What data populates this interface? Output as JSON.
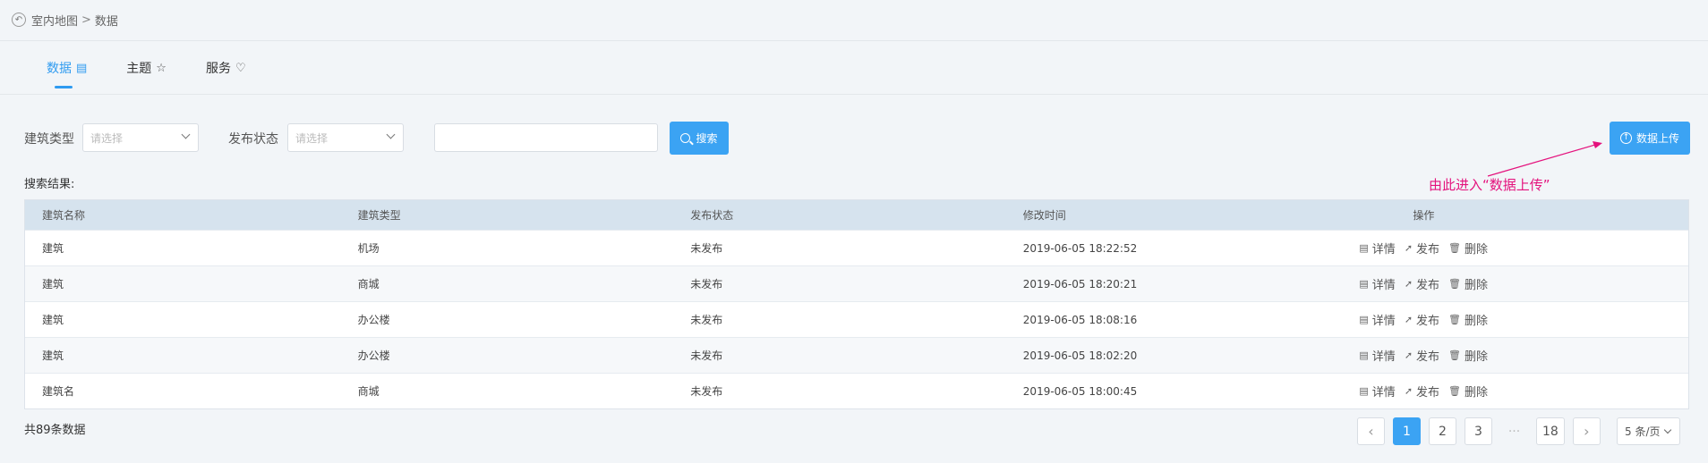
{
  "breadcrumb": {
    "parent": "室内地图",
    "separator": ">",
    "current": "数据"
  },
  "tabs": [
    {
      "label": "数据",
      "icon": "data-icon",
      "glyph": "▤"
    },
    {
      "label": "主题",
      "icon": "star-icon",
      "glyph": "☆"
    },
    {
      "label": "服务",
      "icon": "heart-icon",
      "glyph": "♡"
    }
  ],
  "filters": {
    "building_type_label": "建筑类型",
    "building_type_placeholder": "请选择",
    "publish_status_label": "发布状态",
    "publish_status_placeholder": "请选择",
    "search_value": "",
    "search_button": "搜索",
    "upload_button": "数据上传"
  },
  "annotation": "由此进入“数据上传”",
  "results_title": "搜索结果:",
  "table": {
    "headers": [
      "建筑名称",
      "建筑类型",
      "发布状态",
      "修改时间",
      "操作"
    ],
    "rows": [
      {
        "name": "建筑",
        "type": "机场",
        "status": "未发布",
        "time": "2019-06-05 18:22:52"
      },
      {
        "name": "建筑",
        "type": "商城",
        "status": "未发布",
        "time": "2019-06-05 18:20:21"
      },
      {
        "name": "建筑",
        "type": "办公楼",
        "status": "未发布",
        "time": "2019-06-05 18:08:16"
      },
      {
        "name": "建筑",
        "type": "办公楼",
        "status": "未发布",
        "time": "2019-06-05 18:02:20"
      },
      {
        "name": "建筑名",
        "type": "商城",
        "status": "未发布",
        "time": "2019-06-05 18:00:45"
      }
    ],
    "ops": [
      "详情",
      "发布",
      "删除"
    ]
  },
  "pagination": {
    "total": "共89条数据",
    "pages": [
      "1",
      "2",
      "3",
      "···",
      "18"
    ],
    "current": "1",
    "page_size": "5 条/页"
  },
  "colors": {
    "accent": "#3ba3f3",
    "annotation": "#e4127d",
    "header_bg": "#d6e3ee"
  }
}
